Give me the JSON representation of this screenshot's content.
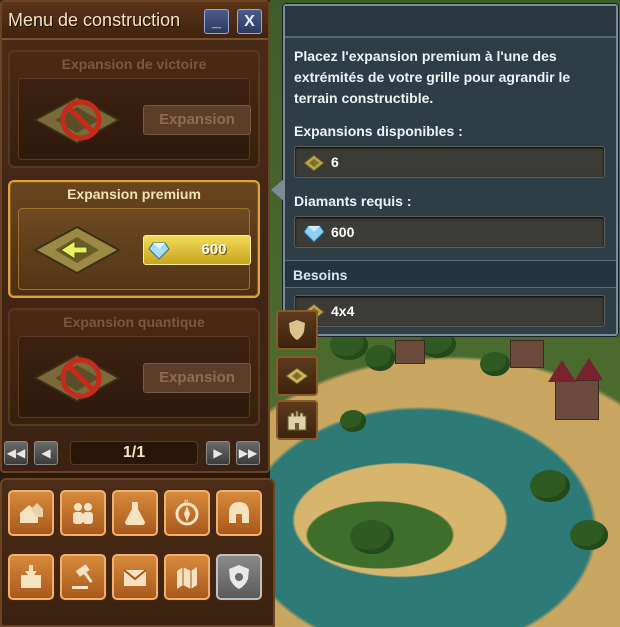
{
  "window": {
    "title": "Menu de construction",
    "minimize_label": "_",
    "close_label": "X"
  },
  "cards": [
    {
      "title": "Expansion de victoire",
      "button_label": "Expansion",
      "state": "disabled"
    },
    {
      "title": "Expansion premium",
      "price": "600",
      "state": "selected"
    },
    {
      "title": "Expansion quantique",
      "button_label": "Expansion",
      "state": "disabled"
    }
  ],
  "pager": {
    "page": "1/1",
    "first_icon": "double-chevron-left-icon",
    "prev_icon": "chevron-left-icon",
    "next_icon": "chevron-right-icon",
    "last_icon": "double-chevron-right-icon"
  },
  "tooltip": {
    "description": "Placez l'expansion premium à l'une des extrémités de votre grille pour agrandir le terrain constructible.",
    "available_label": "Expansions disponibles :",
    "available_value": "6",
    "diamonds_label": "Diamants requis :",
    "diamonds_value": "600",
    "needs_header": "Besoins",
    "needs_value": "4x4"
  },
  "categories": [
    {
      "name": "residential",
      "icon": "houses-icon"
    },
    {
      "name": "culture",
      "icon": "people-icon"
    },
    {
      "name": "goods",
      "icon": "flask-icon"
    },
    {
      "name": "military",
      "icon": "compass-icon"
    },
    {
      "name": "guild",
      "icon": "helmet-icon"
    },
    {
      "name": "storage",
      "icon": "inventory-icon"
    },
    {
      "name": "auction",
      "icon": "gavel-icon"
    },
    {
      "name": "mail",
      "icon": "envelope-icon"
    },
    {
      "name": "expansion",
      "icon": "expansion-map-icon"
    },
    {
      "name": "disabled",
      "icon": "shield-icon"
    }
  ],
  "colors": {
    "panel_brown": "#3b2212",
    "selected_gold": "#d9a441",
    "tooltip_bg": "#2f3d47",
    "category_orange": "#c97430"
  }
}
